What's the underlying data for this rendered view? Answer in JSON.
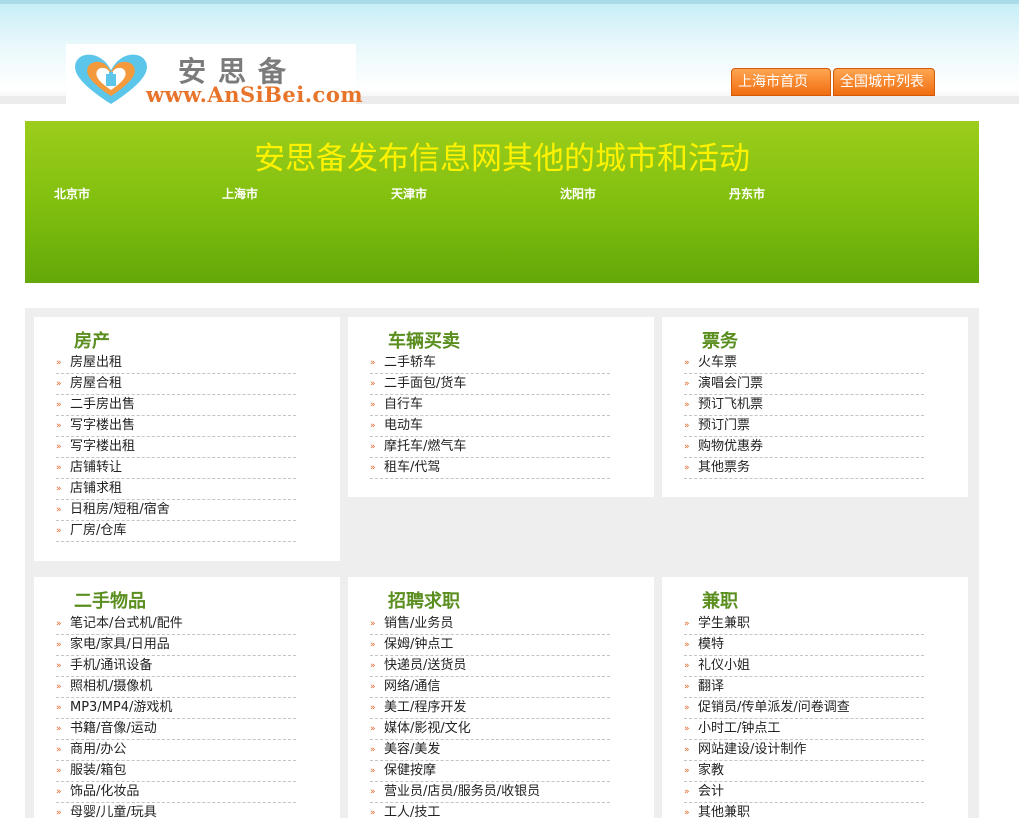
{
  "header": {
    "logo_cn": "安思备",
    "logo_en": "www.AnSiBei.com",
    "nav": [
      "上海市首页",
      "全国城市列表"
    ]
  },
  "banner": {
    "title": "安思备发布信息网其他的城市和活动",
    "cities": [
      "北京市",
      "上海市",
      "天津市",
      "沈阳市",
      "丹东市"
    ]
  },
  "categories": [
    {
      "title": "房产",
      "items": [
        "房屋出租",
        "房屋合租",
        "二手房出售",
        "写字楼出售",
        "写字楼出租",
        "店铺转让",
        "店铺求租",
        "日租房/短租/宿舍",
        "厂房/仓库"
      ]
    },
    {
      "title": "车辆买卖",
      "items": [
        "二手轿车",
        "二手面包/货车",
        "自行车",
        "电动车",
        "摩托车/燃气车",
        "租车/代驾"
      ]
    },
    {
      "title": "票务",
      "items": [
        "火车票",
        "演唱会门票",
        "预订飞机票",
        "预订门票",
        "购物优惠券",
        "其他票务"
      ]
    },
    {
      "title": "二手物品",
      "items": [
        "笔记本/台式机/配件",
        "家电/家具/日用品",
        "手机/通讯设备",
        "照相机/摄像机",
        "MP3/MP4/游戏机",
        "书籍/音像/运动",
        "商用/办公",
        "服装/箱包",
        "饰品/化妆品",
        "母婴/儿童/玩具"
      ]
    },
    {
      "title": "招聘求职",
      "items": [
        "销售/业务员",
        "保姆/钟点工",
        "快递员/送货员",
        "网络/通信",
        "美工/程序开发",
        "媒体/影视/文化",
        "美容/美发",
        "保健按摩",
        "营业员/店员/服务员/收银员",
        "工人/技工"
      ]
    },
    {
      "title": "兼职",
      "items": [
        "学生兼职",
        "模特",
        "礼仪小姐",
        "翻译",
        "促销员/传单派发/问卷调查",
        "小时工/钟点工",
        "网站建设/设计制作",
        "家教",
        "会计",
        "其他兼职"
      ]
    }
  ],
  "colors": {
    "banner_green": "#7fbe0e",
    "banner_title": "#fff200",
    "category_title": "#5a8e1e",
    "nav_orange": "#f06d10",
    "bullet": "#e0662a"
  }
}
